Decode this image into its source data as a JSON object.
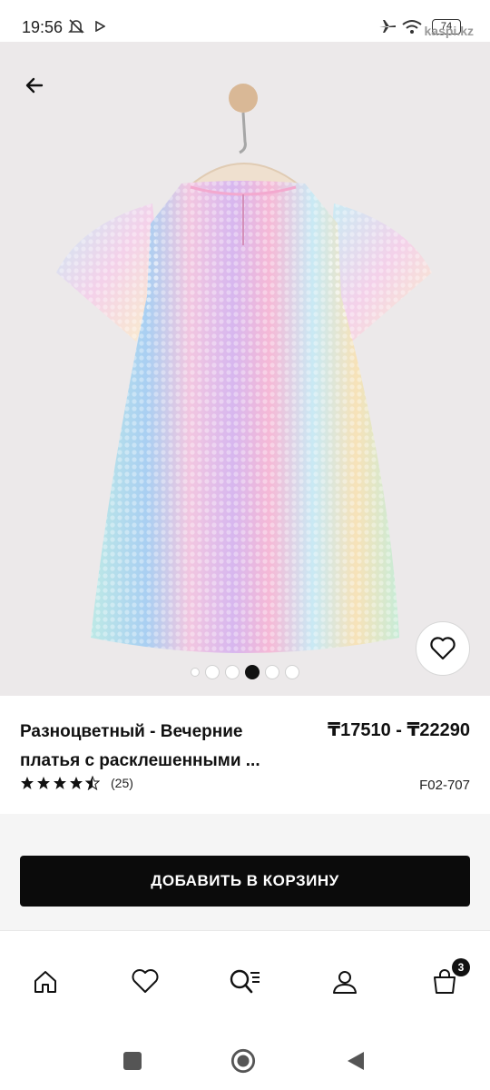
{
  "status_bar": {
    "time": "19:56",
    "battery": "74",
    "watermark": "kaspi.kz"
  },
  "gallery": {
    "image_count": 6,
    "active_index": 3,
    "accent_colors": [
      "#f4c7dd",
      "#c8b6f0",
      "#a8e3e6",
      "#fde7b8"
    ]
  },
  "product": {
    "title": "Разноцветный - Вечерние платья с расклешенными ...",
    "price": "₸17510 - ₸22290",
    "rating_value": 4.5,
    "rating_count": "(25)",
    "sku": "F02-707"
  },
  "cart": {
    "add_label": "ДОБАВИТЬ В КОРЗИНУ"
  },
  "nav": {
    "cart_badge": "3",
    "items": [
      "home-icon",
      "heart-icon",
      "search-icon",
      "profile-icon",
      "bag-icon"
    ]
  }
}
